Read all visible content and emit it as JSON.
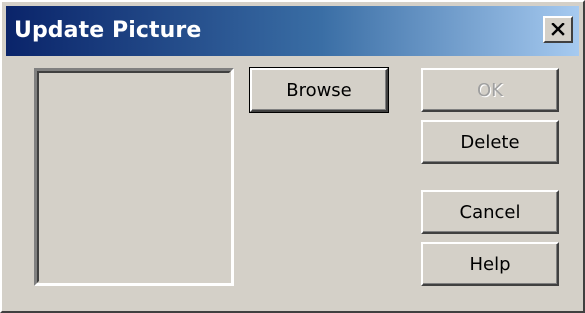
{
  "window": {
    "title": "Update Picture",
    "close_icon": "close-icon"
  },
  "picture_preview": {
    "icon": "empty-picture-frame"
  },
  "buttons": {
    "browse_label": "Browse",
    "ok_label": "OK",
    "ok_enabled": false,
    "delete_label": "Delete",
    "cancel_label": "Cancel",
    "help_label": "Help"
  },
  "colors": {
    "titlebar_start": "#0a246a",
    "titlebar_end": "#a6caf0",
    "dialog_face": "#d4d0c8",
    "disabled_text": "#a0a0a0"
  }
}
